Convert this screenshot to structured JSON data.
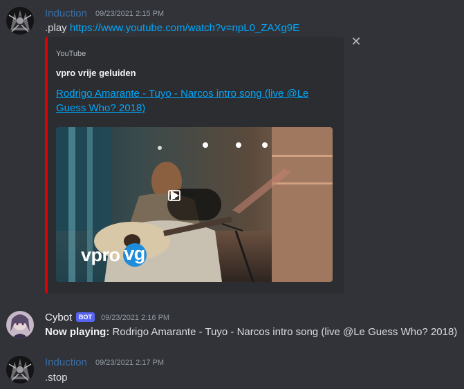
{
  "messages": [
    {
      "username": "Induction",
      "timestamp": "09/23/2021 2:15 PM",
      "command": ".play",
      "link": "https://www.youtube.com/watch?v=npL0_ZAXg9E",
      "username_color": "#3a6ea5"
    },
    {
      "username": "Cybot",
      "bot_tag": "BOT",
      "timestamp": "09/23/2021 2:16 PM",
      "label": "Now playing:",
      "text": "Rodrigo Amarante - Tuyo - Narcos intro song (live @Le Guess Who? 2018)",
      "username_color": "#f2f3f5"
    },
    {
      "username": "Induction",
      "timestamp": "09/23/2021 2:17 PM",
      "text": ".stop",
      "username_color": "#3a6ea5"
    }
  ],
  "embed": {
    "provider": "YouTube",
    "author": "vpro vrije geluiden",
    "title": "Rodrigo Amarante - Tuyo - Narcos intro song (live @Le Guess Who? 2018)",
    "close_icon": "close-icon",
    "accent_color": "#e00000",
    "video": {
      "logo_text": "vpro",
      "logo_circle_text": "vg",
      "play_icon": "play-icon",
      "external_icon": "open-external-icon"
    }
  }
}
